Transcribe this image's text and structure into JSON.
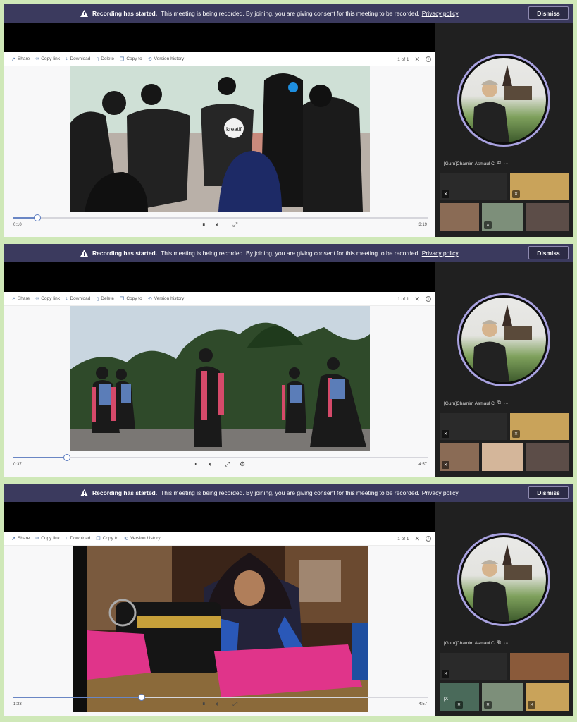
{
  "banner": {
    "title": "Recording has started.",
    "message": "This meeting is being recorded. By joining, you are giving consent for this meeting to be recorded.",
    "policy_link": "Privacy policy",
    "dismiss": "Dismiss"
  },
  "toolbar": {
    "share": "Share",
    "copy_link": "Copy link",
    "download": "Download",
    "delete": "Delete",
    "copy_to": "Copy to",
    "version_history": "Version history",
    "page_count": "1 of 1"
  },
  "participant": {
    "name": "[Guru]Chamim Asmaul C",
    "short_name": "[X"
  },
  "players": [
    {
      "current_time": "0:10",
      "duration": "3:19",
      "progress": 0.06,
      "show_delete": true,
      "shirt_text": "kreatif"
    },
    {
      "current_time": "0:37",
      "duration": "4:57",
      "progress": 0.13,
      "show_delete": true
    },
    {
      "current_time": "1:33",
      "duration": "4:57",
      "progress": 0.31,
      "show_delete": false
    }
  ],
  "colors": {
    "banner_bg": "#3b3a5e",
    "accent": "#6a86c4",
    "ring": "#a9a2e0",
    "frame": "#cfe8b8"
  }
}
